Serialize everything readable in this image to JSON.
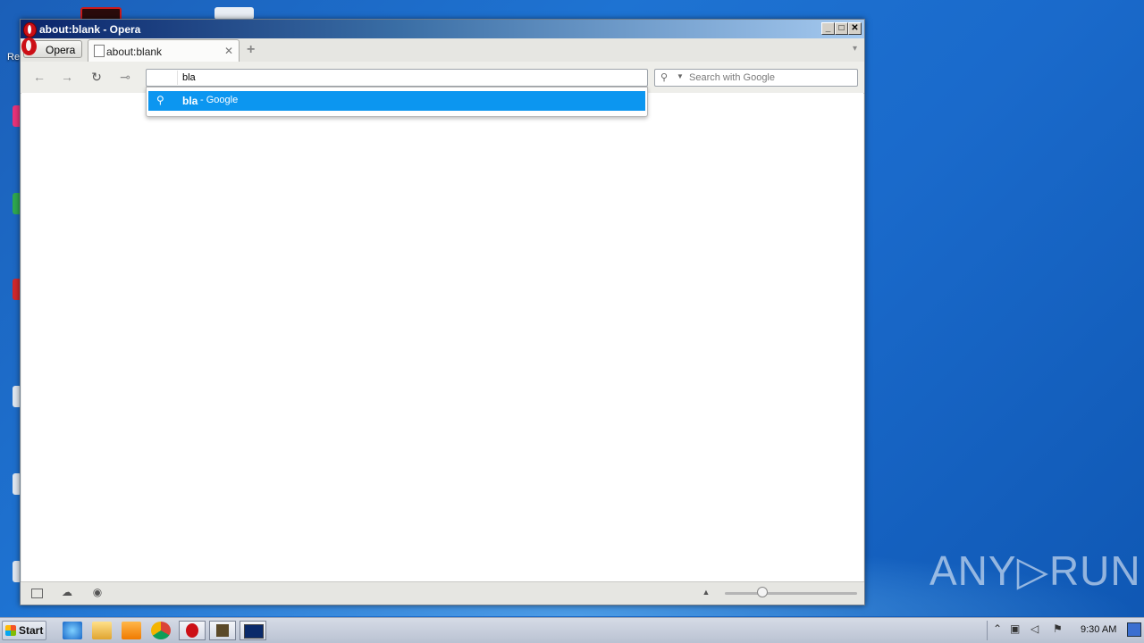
{
  "window": {
    "title": "about:blank - Opera"
  },
  "opera_menu": {
    "label": "Opera"
  },
  "tabs": [
    {
      "label": "about:blank",
      "close": "✕"
    }
  ],
  "new_tab": "+",
  "address_bar": {
    "value": "bla"
  },
  "search_box": {
    "placeholder": "Search with Google"
  },
  "suggestion": {
    "query": "bla",
    "source": "- Google"
  },
  "desktop": {
    "recycle_label": "Re"
  },
  "taskbar": {
    "start_label": "Start",
    "clock": "9:30 AM"
  },
  "watermark": "ANY▷RUN",
  "icons": {
    "back": "←",
    "forward": "→",
    "reload": "↻",
    "key": "⊸",
    "search": "🔍",
    "dropdown": "▼",
    "tab_menu": "▾"
  }
}
